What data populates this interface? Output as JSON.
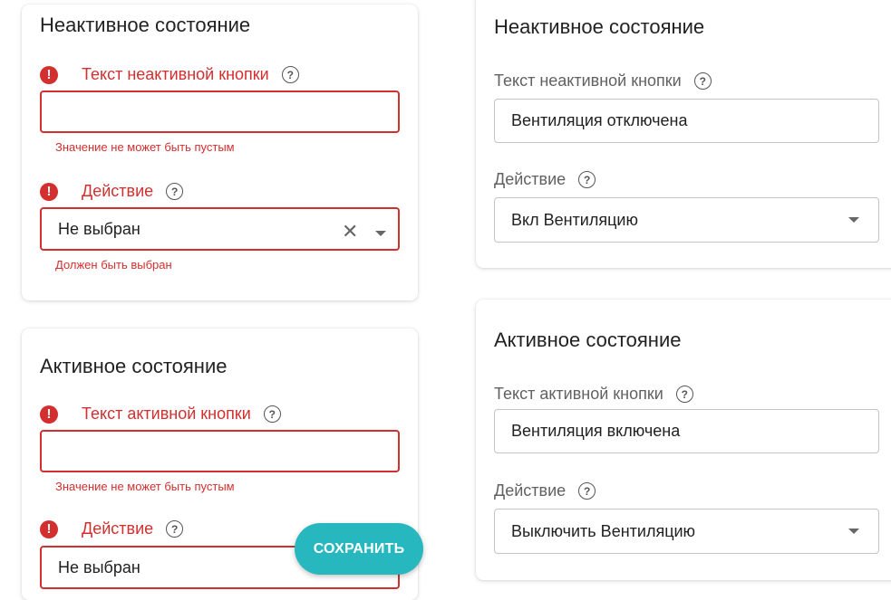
{
  "left": {
    "inactive": {
      "title": "Неактивное состояние",
      "text_label": "Текст неактивной кнопки",
      "text_value": "",
      "text_error": "Значение не может быть пустым",
      "action_label": "Действие",
      "action_value": "Не выбран",
      "action_error": "Должен быть выбран"
    },
    "active": {
      "title": "Активное состояние",
      "text_label": "Текст активной кнопки",
      "text_value": "",
      "text_error": "Значение не может быть пустым",
      "action_label": "Действие",
      "action_value": "Не выбран"
    }
  },
  "right": {
    "inactive": {
      "title": "Неактивное состояние",
      "text_label": "Текст неактивной кнопки",
      "text_value": "Вентиляция отключена",
      "action_label": "Действие",
      "action_value": "Вкл Вентиляцию"
    },
    "active": {
      "title": "Активное состояние",
      "text_label": "Текст активной кнопки",
      "text_value": "Вентиляция включена",
      "action_label": "Действие",
      "action_value": "Выключить Вентиляцию"
    }
  },
  "icons": {
    "error": "error-circle-icon",
    "help": "help-circle-icon",
    "clear": "close-icon",
    "dropdown": "chevron-down-icon"
  },
  "save_button_label": "СОХРАНИТЬ",
  "colors": {
    "error": "#d32f2f",
    "accent": "#26b7bf"
  }
}
